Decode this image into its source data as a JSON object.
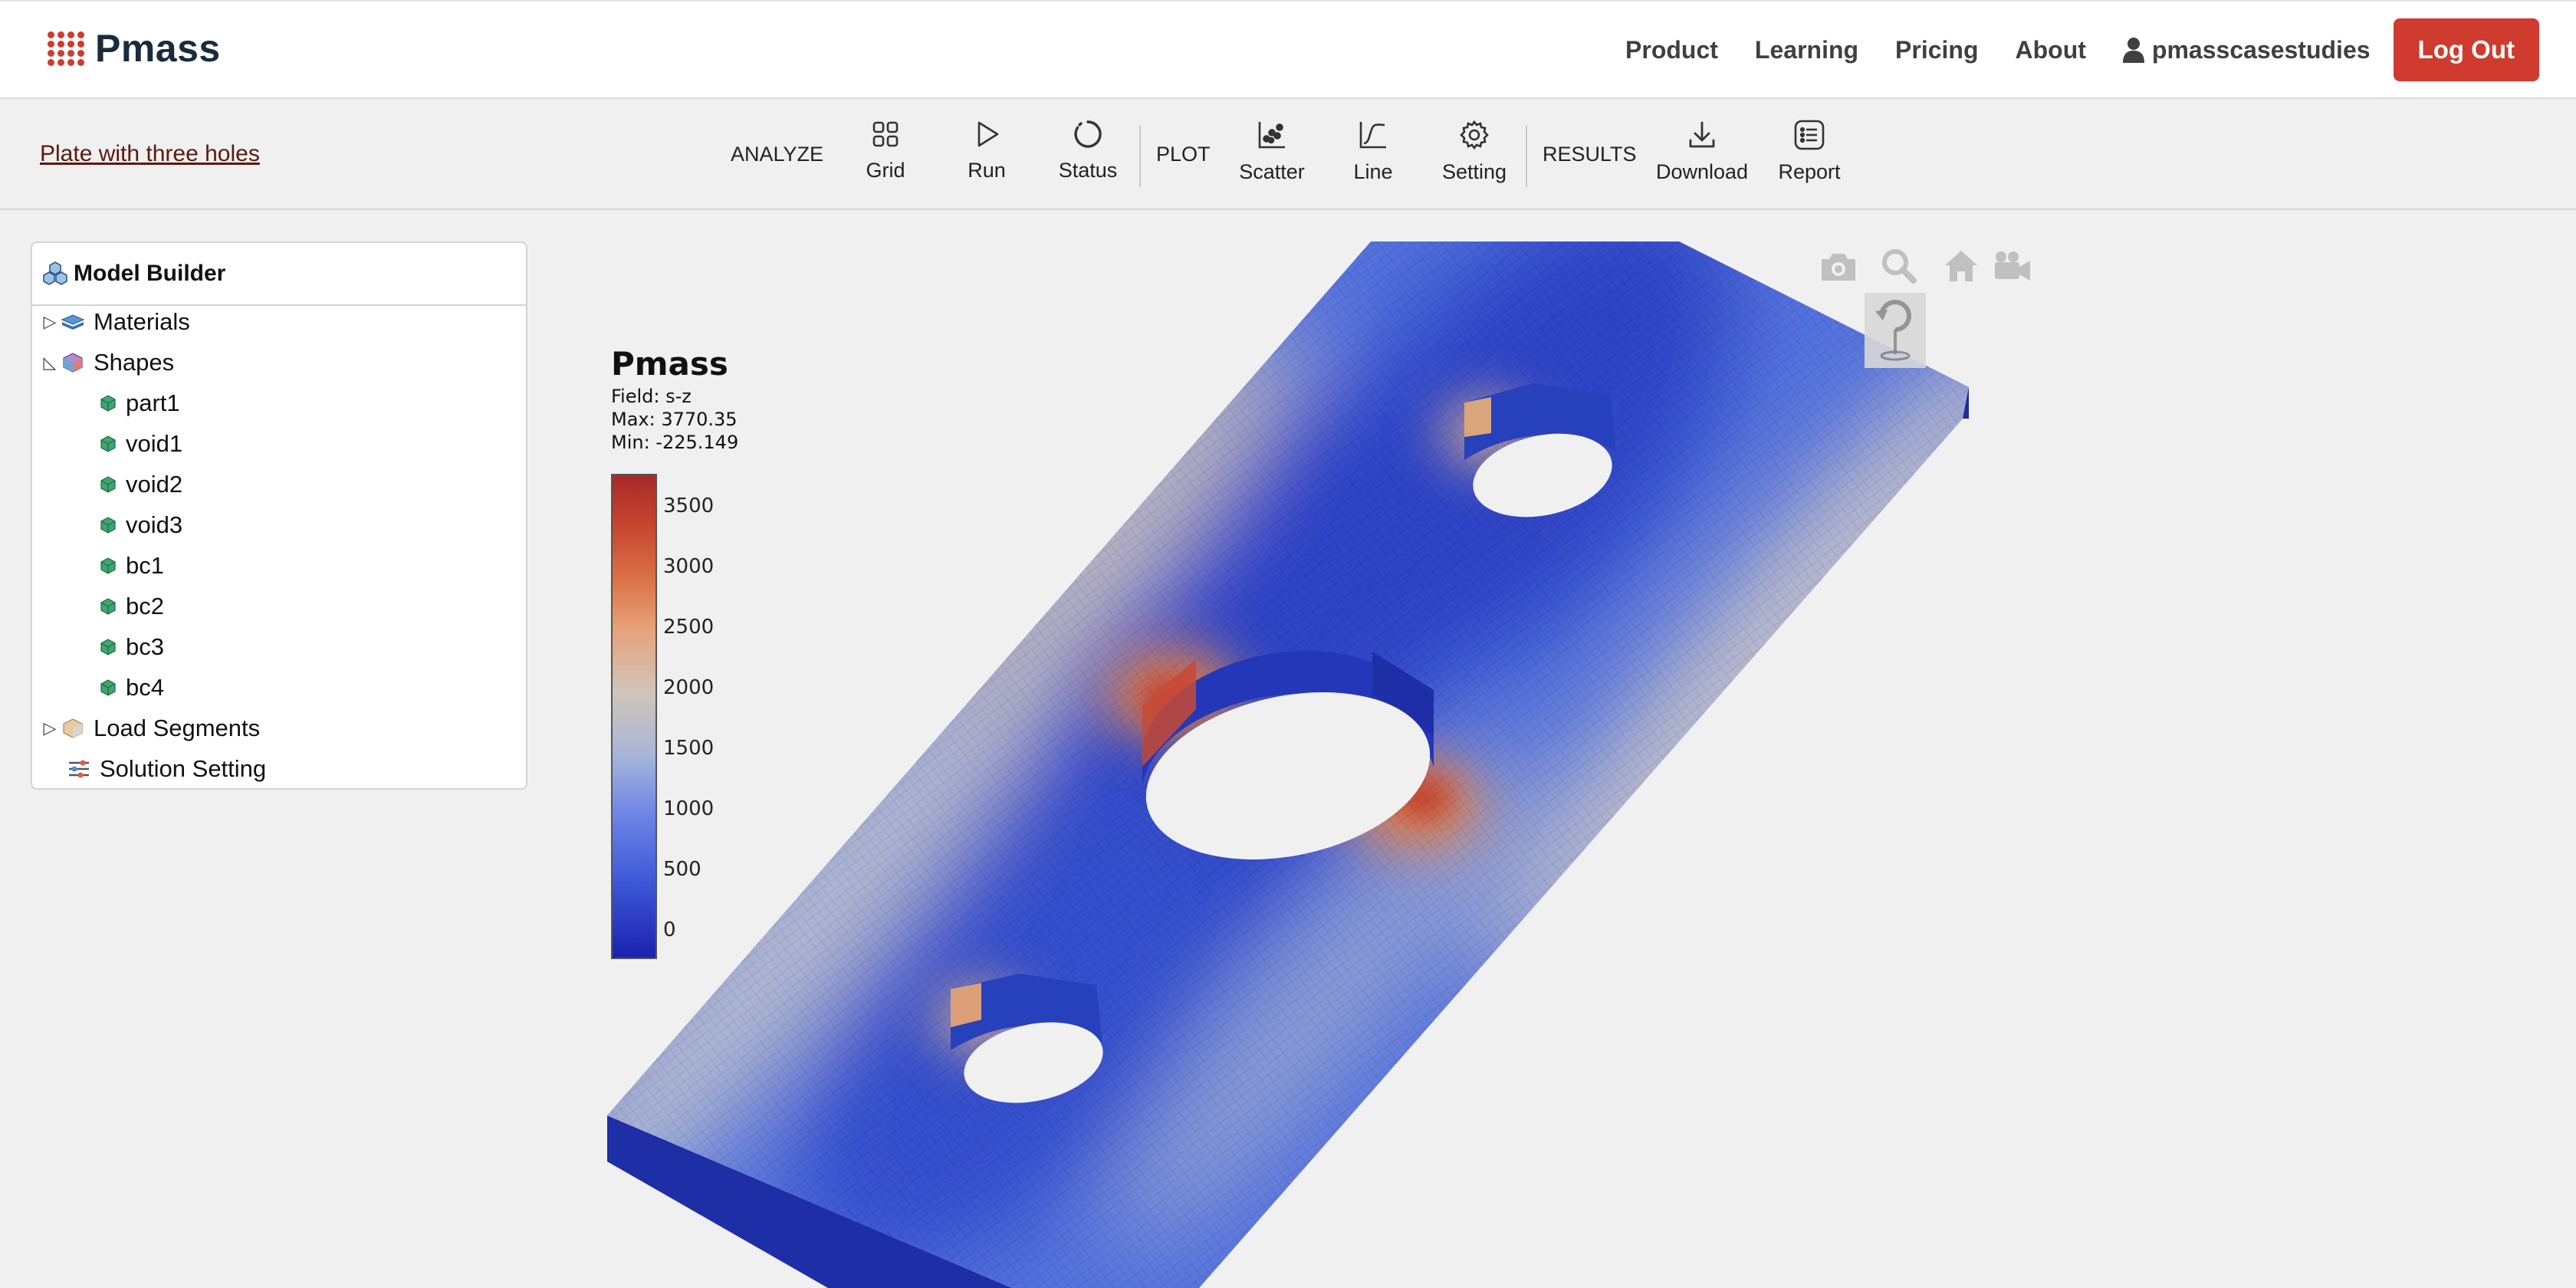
{
  "app": {
    "name": "Pmass"
  },
  "nav": {
    "links": [
      "Product",
      "Learning",
      "Pricing",
      "About"
    ],
    "user": "pmasscasestudies",
    "logout": "Log Out"
  },
  "toolbar": {
    "project": "Plate with three holes",
    "analyze_label": "ANALYZE",
    "grid": "Grid",
    "run": "Run",
    "status": "Status",
    "plot_label": "PLOT",
    "scatter": "Scatter",
    "line": "Line",
    "setting": "Setting",
    "results_label": "RESULTS",
    "download": "Download",
    "report": "Report"
  },
  "model_builder": {
    "title": "Model Builder",
    "materials": "Materials",
    "shapes": "Shapes",
    "shape_items": [
      "part1",
      "void1",
      "void2",
      "void3",
      "bc1",
      "bc2",
      "bc3",
      "bc4"
    ],
    "load_segments": "Load Segments",
    "solution_setting": "Solution Setting"
  },
  "legend": {
    "title": "Pmass",
    "field": "Field: s-z",
    "max": "Max: 3770.35",
    "min": "Min: -225.149",
    "ticks": [
      "3500",
      "3000",
      "2500",
      "2000",
      "1500",
      "1000",
      "500",
      "0"
    ]
  },
  "viewport_controls": [
    "camera-icon",
    "zoom-icon",
    "home-icon",
    "video-camera-icon",
    "rotate-icon"
  ],
  "colors": {
    "brand": "#cf3b2e",
    "nav_text": "#404040",
    "link": "#5a1a10"
  }
}
